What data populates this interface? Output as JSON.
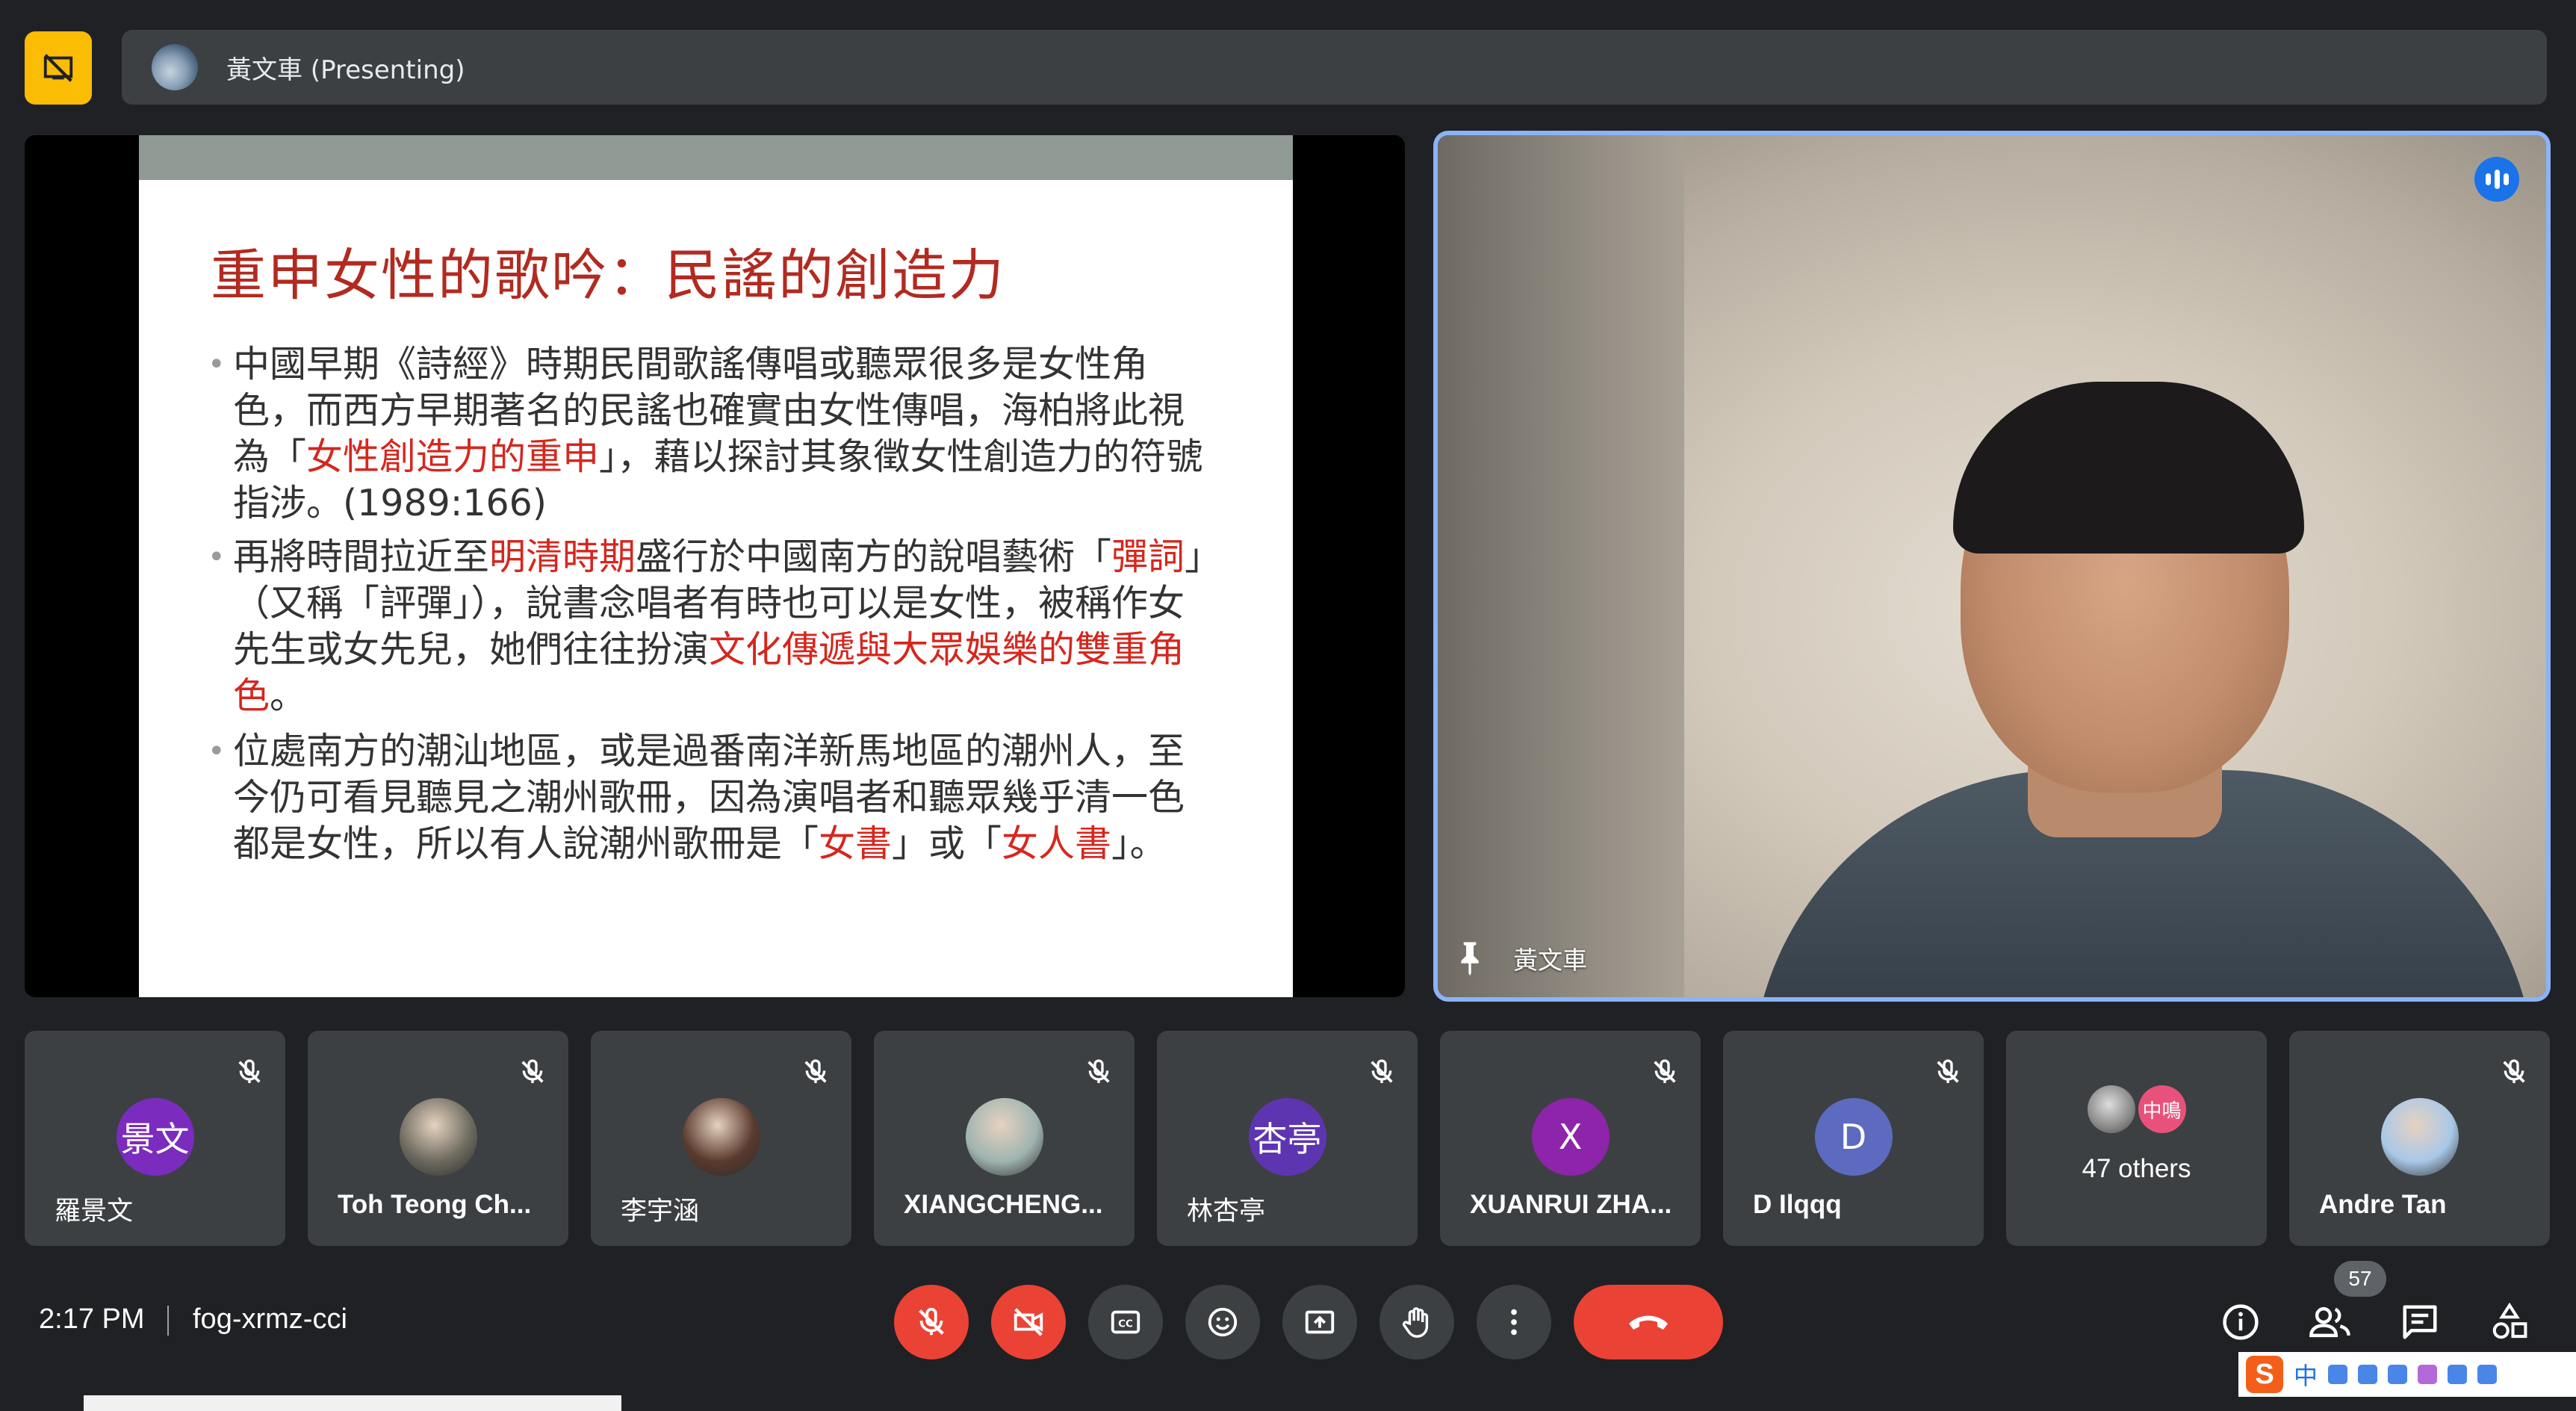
{
  "top_bar": {
    "presenting_text": "黃文車 (Presenting)"
  },
  "slide": {
    "title": "重申女性的歌吟：民謠的創造力",
    "bullets": [
      {
        "segments": [
          {
            "text": "中國早期《詩經》時期民間歌謠傳唱或聽眾很多是女性角色，而西方早期著名的民謠也確實由女性傳唱，海柏將此視為「",
            "red": false
          },
          {
            "text": "女性創造力的重申",
            "red": true
          },
          {
            "text": "」，藉以探討其象徵女性創造力的符號指涉。(1989:166)",
            "red": false
          }
        ]
      },
      {
        "segments": [
          {
            "text": "再將時間拉近至",
            "red": false
          },
          {
            "text": "明清時期",
            "red": true
          },
          {
            "text": "盛行於中國南方的說唱藝術「",
            "red": false
          },
          {
            "text": "彈詞",
            "red": true
          },
          {
            "text": "」（又稱「評彈」），說書念唱者有時也可以是女性，被稱作女先生或女先兒，她們往往扮演",
            "red": false
          },
          {
            "text": "文化傳遞與大眾娛樂的雙重角色",
            "red": true
          },
          {
            "text": "。",
            "red": false
          }
        ]
      },
      {
        "segments": [
          {
            "text": "位處南方的潮汕地區，或是過番南洋新馬地區的潮州人，至今仍可看見聽見之潮州歌冊，因為演唱者和聽眾幾乎清一色都是女性，所以有人說潮州歌冊是「",
            "red": false
          },
          {
            "text": "女書",
            "red": true
          },
          {
            "text": "」或「",
            "red": false
          },
          {
            "text": "女人書",
            "red": true
          },
          {
            "text": "」。",
            "red": false
          }
        ]
      }
    ]
  },
  "main_video": {
    "name": "黃文車"
  },
  "tiles": [
    {
      "name": "羅景文",
      "avatar_text": "景文",
      "avatar_color": "#7b2cbf",
      "type": "letter",
      "cjk": true
    },
    {
      "name": "Toh Teong Ch...",
      "avatar_text": "",
      "avatar_color": "#6d6a5f",
      "type": "photo",
      "cjk": false
    },
    {
      "name": "李宇涵",
      "avatar_text": "",
      "avatar_color": "#5a3a2e",
      "type": "photo",
      "cjk": true
    },
    {
      "name": "XIANGCHENG...",
      "avatar_text": "",
      "avatar_color": "#9fb4b0",
      "type": "photo",
      "cjk": false
    },
    {
      "name": "林杏亭",
      "avatar_text": "杏亭",
      "avatar_color": "#5e35b1",
      "type": "letter",
      "cjk": true
    },
    {
      "name": "XUANRUI ZHA...",
      "avatar_text": "X",
      "avatar_color": "#8e24aa",
      "type": "letter",
      "cjk": false
    },
    {
      "name": "D Ilqqq",
      "avatar_text": "D",
      "avatar_color": "#5c6bc0",
      "type": "letter",
      "cjk": false
    },
    {
      "name": "47 others",
      "avatar_text": "中鳴",
      "avatar_color": "#e8527a",
      "type": "others",
      "cjk": false
    },
    {
      "name": "Andre Tan",
      "avatar_text": "",
      "avatar_color": "#a9c8e8",
      "type": "photo",
      "cjk": false
    }
  ],
  "bottom_bar": {
    "time": "2:17 PM",
    "meeting_code": "fog-xrmz-cci",
    "people_count": "57"
  },
  "ime": {
    "logo": "S",
    "mode": "中"
  },
  "colors": {
    "background": "#202124",
    "tile": "#3c4043",
    "danger": "#ea4335",
    "accent_border": "#8ab4f8",
    "present_button": "#fbbc04"
  },
  "icons": [
    "stop-presenting-icon",
    "mic-off-icon",
    "camera-off-icon",
    "captions-icon",
    "emoji-icon",
    "present-screen-icon",
    "raise-hand-icon",
    "more-options-icon",
    "end-call-icon",
    "info-icon",
    "people-icon",
    "chat-icon",
    "activities-icon",
    "pin-icon",
    "speaking-indicator-icon"
  ]
}
